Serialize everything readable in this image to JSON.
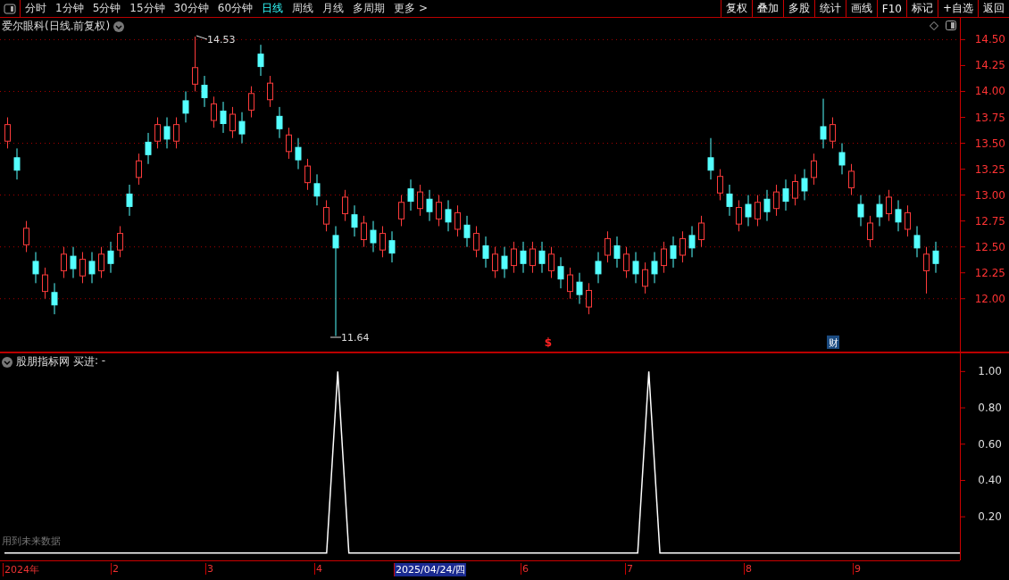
{
  "toolbar": {
    "periods": [
      {
        "label": "分时",
        "selected": false
      },
      {
        "label": "1分钟",
        "selected": false
      },
      {
        "label": "5分钟",
        "selected": false
      },
      {
        "label": "15分钟",
        "selected": false
      },
      {
        "label": "30分钟",
        "selected": false
      },
      {
        "label": "60分钟",
        "selected": false
      },
      {
        "label": "日线",
        "selected": true
      },
      {
        "label": "周线",
        "selected": false
      },
      {
        "label": "月线",
        "selected": false
      },
      {
        "label": "多周期",
        "selected": false
      },
      {
        "label": "更多 >",
        "selected": false
      }
    ],
    "buttons": [
      "复权",
      "叠加",
      "多股",
      "统计",
      "画线",
      "F10",
      "标记",
      "+自选",
      "返回"
    ]
  },
  "price_chart": {
    "title": "爱尔眼科(日线.前复权)",
    "high_label": "14.53",
    "low_label": "11.64",
    "markers": [
      {
        "kind": "dividend",
        "text": "$"
      },
      {
        "kind": "report",
        "text": "财"
      }
    ],
    "chart_data": {
      "type": "candlestick",
      "ylim": [
        11.49,
        14.71
      ],
      "grid": true,
      "yticks": [
        {
          "value": 14.5,
          "label": "14.50"
        },
        {
          "value": 14.25,
          "label": "14.25"
        },
        {
          "value": 14,
          "label": "14.00"
        },
        {
          "value": 13.75,
          "label": "13.75"
        },
        {
          "value": 13.5,
          "label": "13.50"
        },
        {
          "value": 13.25,
          "label": "13.25"
        },
        {
          "value": 13,
          "label": "13.00"
        },
        {
          "value": 12.75,
          "label": "12.75"
        },
        {
          "value": 12.5,
          "label": "12.50"
        },
        {
          "value": 12.25,
          "label": "12.25"
        },
        {
          "value": 12,
          "label": "12.00"
        }
      ],
      "ohlc": [
        [
          13.52,
          13.75,
          13.45,
          13.68
        ],
        [
          13.36,
          13.45,
          13.15,
          13.24
        ],
        [
          12.52,
          12.75,
          12.45,
          12.68
        ],
        [
          12.36,
          12.45,
          12.15,
          12.24
        ],
        [
          12.07,
          12.3,
          12.0,
          12.23
        ],
        [
          12.06,
          12.15,
          11.85,
          11.94
        ],
        [
          12.27,
          12.5,
          12.2,
          12.43
        ],
        [
          12.41,
          12.5,
          12.2,
          12.29
        ],
        [
          12.22,
          12.45,
          12.15,
          12.38
        ],
        [
          12.36,
          12.45,
          12.15,
          12.24
        ],
        [
          12.27,
          12.5,
          12.2,
          12.43
        ],
        [
          12.46,
          12.55,
          12.25,
          12.34
        ],
        [
          12.47,
          12.7,
          12.4,
          12.63
        ],
        [
          13.01,
          13.1,
          12.8,
          12.89
        ],
        [
          13.17,
          13.4,
          13.1,
          13.33
        ],
        [
          13.51,
          13.6,
          13.3,
          13.39
        ],
        [
          13.52,
          13.75,
          13.45,
          13.68
        ],
        [
          13.66,
          13.75,
          13.45,
          13.54
        ],
        [
          13.52,
          13.75,
          13.45,
          13.68
        ],
        [
          13.91,
          14.0,
          13.7,
          13.79
        ],
        [
          14.07,
          14.53,
          14.0,
          14.23
        ],
        [
          14.06,
          14.15,
          13.85,
          13.94
        ],
        [
          13.72,
          13.95,
          13.65,
          13.88
        ],
        [
          13.81,
          13.9,
          13.6,
          13.69
        ],
        [
          13.62,
          13.85,
          13.55,
          13.78
        ],
        [
          13.71,
          13.8,
          13.5,
          13.59
        ],
        [
          13.82,
          14.05,
          13.75,
          13.98
        ],
        [
          14.36,
          14.45,
          14.15,
          14.24
        ],
        [
          13.92,
          14.15,
          13.85,
          14.08
        ],
        [
          13.76,
          13.85,
          13.55,
          13.64
        ],
        [
          13.42,
          13.65,
          13.35,
          13.58
        ],
        [
          13.46,
          13.55,
          13.25,
          13.34
        ],
        [
          13.12,
          13.35,
          13.05,
          13.28
        ],
        [
          13.11,
          13.2,
          12.9,
          12.99
        ],
        [
          12.72,
          12.95,
          12.65,
          12.88
        ],
        [
          12.61,
          12.7,
          11.64,
          12.49
        ],
        [
          12.82,
          13.05,
          12.75,
          12.98
        ],
        [
          12.81,
          12.9,
          12.6,
          12.69
        ],
        [
          12.57,
          12.8,
          12.5,
          12.73
        ],
        [
          12.66,
          12.75,
          12.45,
          12.54
        ],
        [
          12.47,
          12.7,
          12.4,
          12.63
        ],
        [
          12.56,
          12.65,
          12.35,
          12.44
        ],
        [
          12.77,
          13.0,
          12.7,
          12.93
        ],
        [
          13.06,
          13.15,
          12.85,
          12.94
        ],
        [
          12.87,
          13.1,
          12.8,
          13.03
        ],
        [
          12.96,
          13.05,
          12.75,
          12.84
        ],
        [
          12.77,
          13.0,
          12.7,
          12.93
        ],
        [
          12.86,
          12.95,
          12.65,
          12.74
        ],
        [
          12.67,
          12.9,
          12.6,
          12.83
        ],
        [
          12.71,
          12.8,
          12.5,
          12.59
        ],
        [
          12.47,
          12.7,
          12.4,
          12.63
        ],
        [
          12.51,
          12.6,
          12.3,
          12.39
        ],
        [
          12.27,
          12.5,
          12.2,
          12.43
        ],
        [
          12.41,
          12.5,
          12.2,
          12.29
        ],
        [
          12.32,
          12.55,
          12.25,
          12.48
        ],
        [
          12.46,
          12.55,
          12.25,
          12.34
        ],
        [
          12.32,
          12.55,
          12.25,
          12.48
        ],
        [
          12.46,
          12.55,
          12.25,
          12.34
        ],
        [
          12.27,
          12.5,
          12.2,
          12.43
        ],
        [
          12.31,
          12.4,
          12.1,
          12.19
        ],
        [
          12.07,
          12.3,
          12.0,
          12.23
        ],
        [
          12.16,
          12.25,
          11.95,
          12.04
        ],
        [
          11.92,
          12.15,
          11.85,
          12.08
        ],
        [
          12.36,
          12.45,
          12.15,
          12.24
        ],
        [
          12.42,
          12.65,
          12.35,
          12.58
        ],
        [
          12.51,
          12.6,
          12.3,
          12.39
        ],
        [
          12.27,
          12.5,
          12.2,
          12.43
        ],
        [
          12.36,
          12.45,
          12.15,
          12.24
        ],
        [
          12.12,
          12.35,
          12.05,
          12.28
        ],
        [
          12.36,
          12.45,
          12.15,
          12.24
        ],
        [
          12.32,
          12.55,
          12.25,
          12.48
        ],
        [
          12.51,
          12.6,
          12.3,
          12.39
        ],
        [
          12.42,
          12.65,
          12.35,
          12.58
        ],
        [
          12.61,
          12.7,
          12.4,
          12.49
        ],
        [
          12.57,
          12.8,
          12.5,
          12.73
        ],
        [
          13.36,
          13.55,
          13.15,
          13.24
        ],
        [
          13.02,
          13.25,
          12.95,
          13.18
        ],
        [
          13.01,
          13.1,
          12.8,
          12.89
        ],
        [
          12.72,
          12.95,
          12.65,
          12.88
        ],
        [
          12.91,
          13.0,
          12.7,
          12.79
        ],
        [
          12.77,
          13.0,
          12.7,
          12.93
        ],
        [
          12.96,
          13.05,
          12.75,
          12.84
        ],
        [
          12.87,
          13.1,
          12.8,
          13.03
        ],
        [
          13.06,
          13.15,
          12.85,
          12.94
        ],
        [
          12.97,
          13.2,
          12.9,
          13.13
        ],
        [
          13.16,
          13.25,
          12.95,
          13.04
        ],
        [
          13.17,
          13.4,
          13.1,
          13.33
        ],
        [
          13.66,
          13.93,
          13.45,
          13.54
        ],
        [
          13.52,
          13.75,
          13.45,
          13.68
        ],
        [
          13.41,
          13.5,
          13.2,
          13.29
        ],
        [
          13.07,
          13.3,
          13.0,
          13.23
        ],
        [
          12.91,
          13.0,
          12.7,
          12.79
        ],
        [
          12.57,
          12.8,
          12.5,
          12.73
        ],
        [
          12.91,
          13.0,
          12.7,
          12.79
        ],
        [
          12.82,
          13.05,
          12.75,
          12.98
        ],
        [
          12.86,
          12.95,
          12.65,
          12.74
        ],
        [
          12.67,
          12.9,
          12.6,
          12.83
        ],
        [
          12.61,
          12.7,
          12.4,
          12.49
        ],
        [
          12.27,
          12.5,
          12.05,
          12.43
        ],
        [
          12.46,
          12.55,
          12.25,
          12.34
        ]
      ]
    }
  },
  "indicator": {
    "name": "股朋指标网",
    "reading": ": -",
    "warning": "用到未来数据",
    "chart_data": {
      "type": "line",
      "ylim": [
        -0.04,
        1.1
      ],
      "yticks": [
        {
          "value": 1,
          "label": "1.00"
        },
        {
          "value": 0.8,
          "label": "0.80"
        },
        {
          "value": 0.6,
          "label": "0.60"
        },
        {
          "value": 0.4,
          "label": "0.40"
        },
        {
          "value": 0.2,
          "label": "0.20"
        }
      ],
      "series": [
        {
          "name": "买进",
          "color": "#ffffff",
          "values": [
            0,
            0,
            0,
            0,
            0,
            0,
            0,
            0,
            0,
            0,
            0,
            0,
            0,
            0,
            0,
            0,
            0,
            0,
            0,
            0,
            0,
            0,
            0,
            0,
            0,
            0,
            0,
            0,
            0,
            0,
            1,
            0,
            0,
            0,
            0,
            0,
            0,
            0,
            0,
            0,
            0,
            0,
            0,
            0,
            0,
            0,
            0,
            0,
            0,
            0,
            0,
            0,
            0,
            0,
            0,
            0,
            0,
            0,
            1,
            0,
            0,
            0,
            0,
            0,
            0,
            0,
            0,
            0,
            0,
            0,
            0,
            0,
            0,
            0,
            0,
            0,
            0,
            0,
            0,
            0,
            0,
            0,
            0,
            0,
            0,
            0,
            0
          ]
        }
      ]
    }
  },
  "date_axis": [
    {
      "label": "2024年",
      "selected": false
    },
    {
      "label": "2",
      "selected": false
    },
    {
      "label": "3",
      "selected": false
    },
    {
      "label": "4",
      "selected": false
    },
    {
      "label": "2025/04/24/四",
      "selected": true
    },
    {
      "label": "6",
      "selected": false
    },
    {
      "label": "7",
      "selected": false
    },
    {
      "label": "8",
      "selected": false
    },
    {
      "label": "9",
      "selected": false
    }
  ]
}
